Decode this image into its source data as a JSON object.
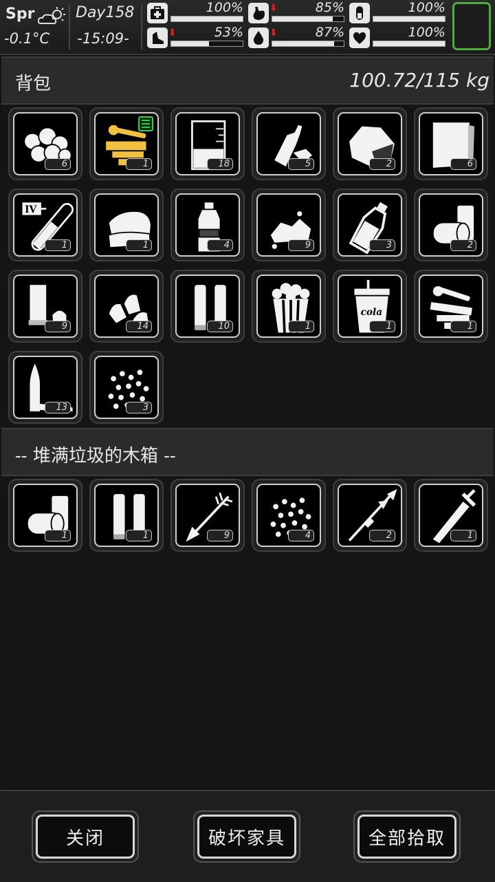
{
  "status": {
    "season": "Spr",
    "temperature": "-0.1°C",
    "day": "Day158",
    "time": "-15:09-",
    "stats": [
      {
        "name": "health",
        "icon": "medkit-icon",
        "value": "100%",
        "level": 1.0,
        "arrow": false
      },
      {
        "name": "hunger",
        "icon": "stomach-icon",
        "value": "85%",
        "level": 0.85,
        "arrow": true
      },
      {
        "name": "mood",
        "icon": "pill-icon",
        "value": "100%",
        "level": 1.0,
        "arrow": false
      },
      {
        "name": "stamina",
        "icon": "foot-icon",
        "value": "53%",
        "level": 0.53,
        "arrow": true
      },
      {
        "name": "thirst",
        "icon": "water-drop-icon",
        "value": "87%",
        "level": 0.87,
        "arrow": true
      },
      {
        "name": "heart",
        "icon": "heart-icon",
        "value": "100%",
        "level": 1.0,
        "arrow": false
      }
    ]
  },
  "backpack": {
    "title": "背包",
    "weight": "100.72/115 kg",
    "items": [
      {
        "icon": "cotton-balls-icon",
        "count": "6"
      },
      {
        "icon": "scrap-gun-parts-icon",
        "count": "1",
        "highlight": true
      },
      {
        "icon": "beaker-icon",
        "count": "18"
      },
      {
        "icon": "crushed-bottle-icon",
        "count": "5"
      },
      {
        "icon": "rock-ore-icon",
        "count": "2"
      },
      {
        "icon": "paper-sheets-icon",
        "count": "6"
      },
      {
        "icon": "iv-tube-icon",
        "count": "1"
      },
      {
        "icon": "folded-cloth-icon",
        "count": "1"
      },
      {
        "icon": "water-bottle-icon",
        "count": "4"
      },
      {
        "icon": "rubble-pile-icon",
        "count": "9"
      },
      {
        "icon": "glass-bottle-icon",
        "count": "3"
      },
      {
        "icon": "tin-cans-icon",
        "count": "2"
      },
      {
        "icon": "shotgun-shell-icon",
        "count": "9"
      },
      {
        "icon": "pistol-bullets-icon",
        "count": "14"
      },
      {
        "icon": "rifle-cartridges-icon",
        "count": "10"
      },
      {
        "icon": "popcorn-icon",
        "count": "1"
      },
      {
        "icon": "cola-cup-icon",
        "count": "1",
        "label": "cola"
      },
      {
        "icon": "scrap-parts-icon",
        "count": "1"
      },
      {
        "icon": "long-bullet-icon",
        "count": "13"
      },
      {
        "icon": "pellets-icon",
        "count": "3"
      }
    ]
  },
  "container": {
    "title": "-- 堆满垃圾的木箱 --",
    "items": [
      {
        "icon": "tin-cans-icon",
        "count": "1"
      },
      {
        "icon": "rifle-cartridges-icon",
        "count": "1"
      },
      {
        "icon": "arrow-icon",
        "count": "9"
      },
      {
        "icon": "pellets-icon",
        "count": "4"
      },
      {
        "icon": "spear-icon",
        "count": "2"
      },
      {
        "icon": "sword-icon",
        "count": "1"
      }
    ]
  },
  "buttons": {
    "close": "关闭",
    "destroy": "破坏家具",
    "take_all": "全部拾取"
  },
  "colors": {
    "accent_green": "#4caf3a",
    "highlight_gold": "#f0c040",
    "warn_red": "#e02020"
  }
}
